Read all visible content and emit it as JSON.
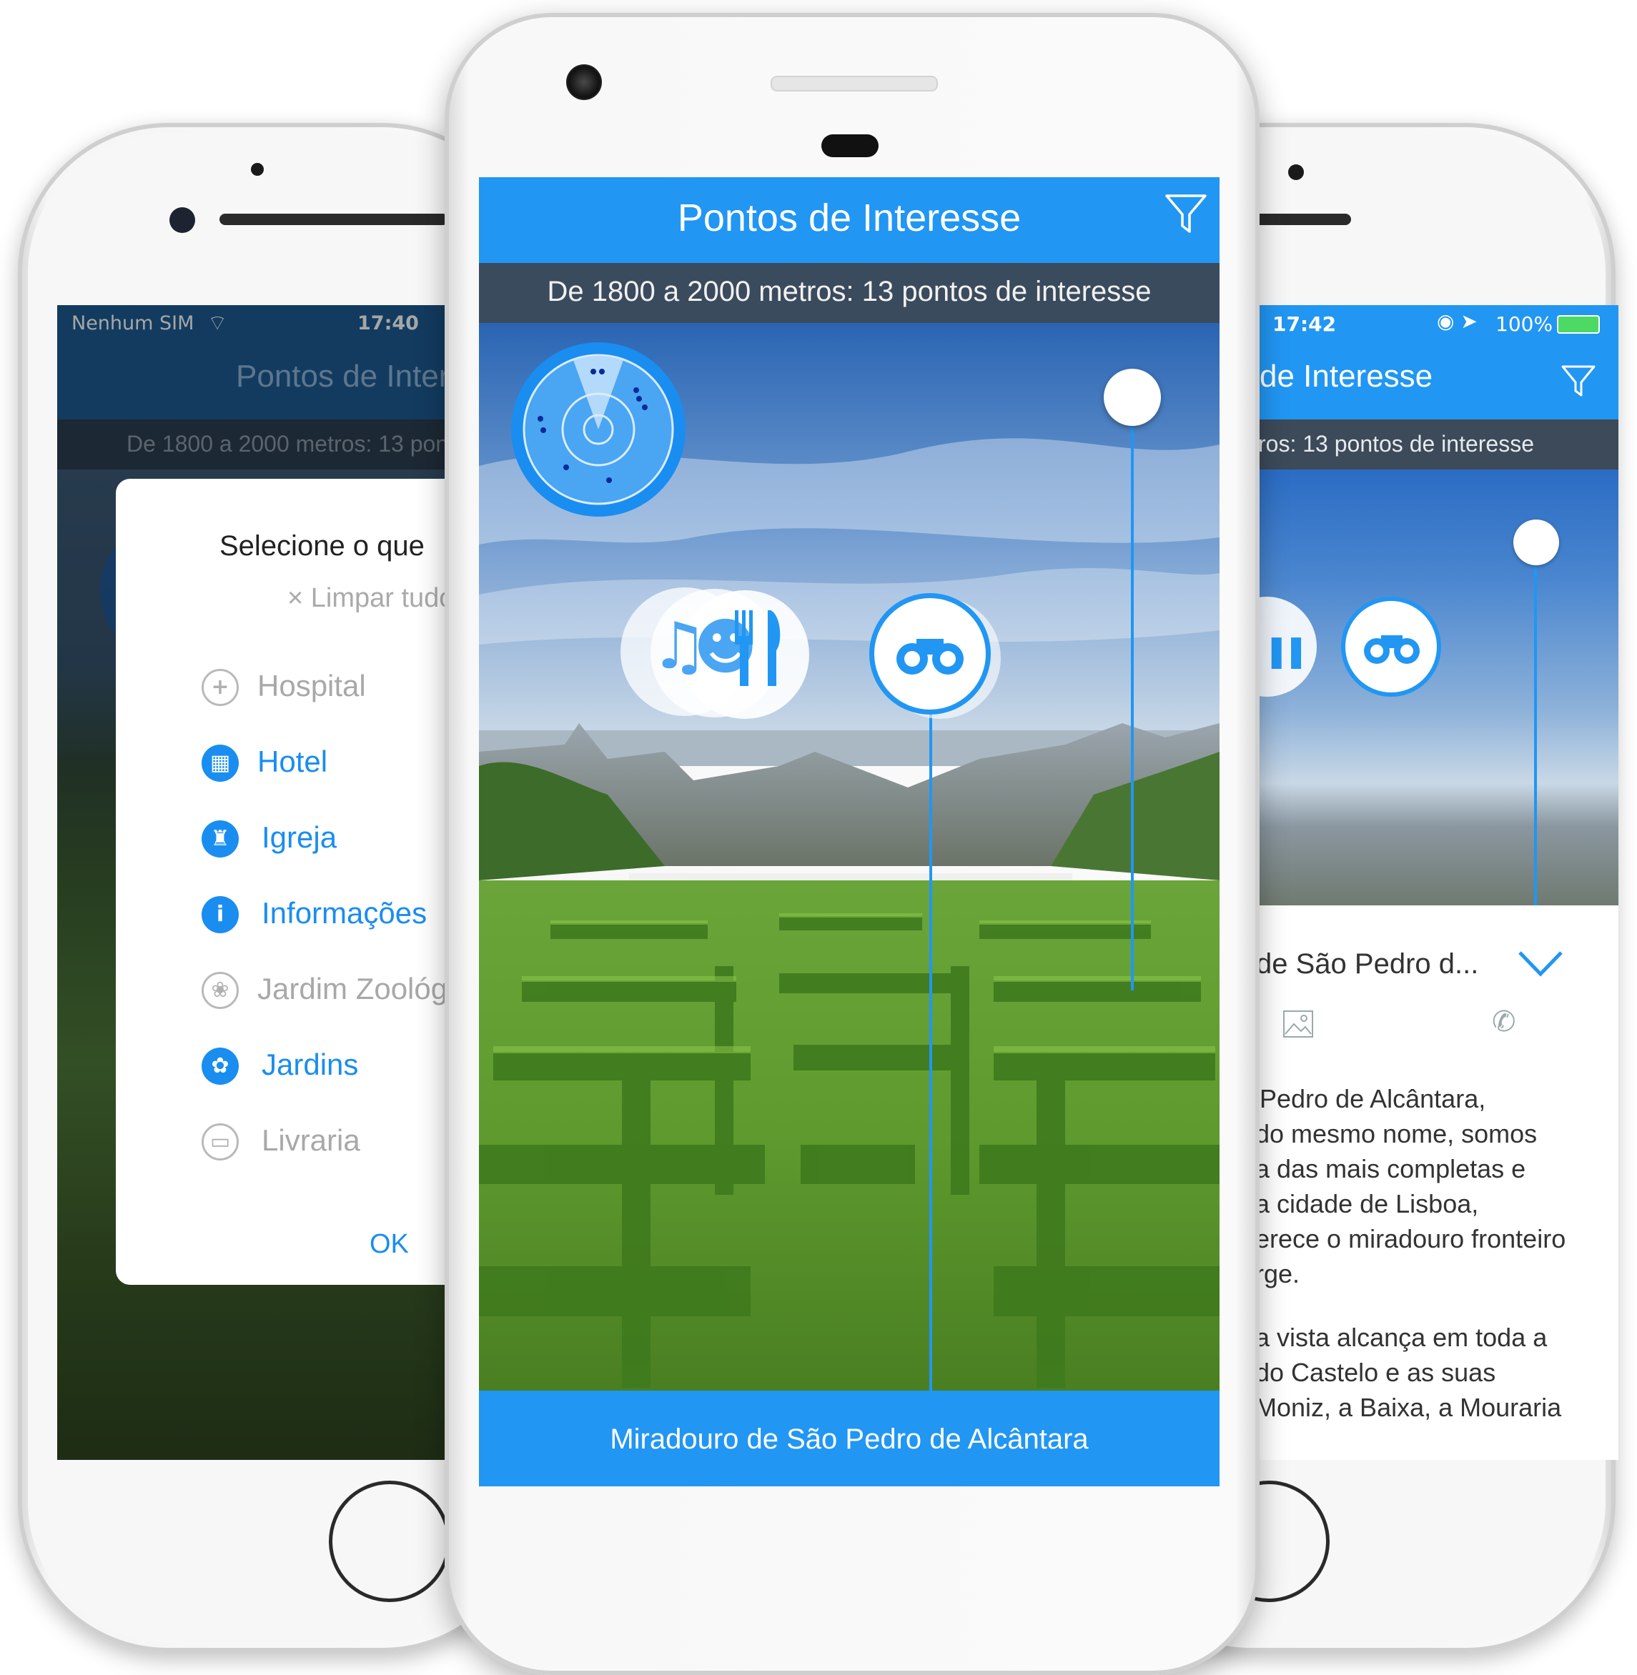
{
  "left_phone": {
    "status": {
      "carrier": "Nenhum SIM",
      "time": "17:40"
    },
    "nav_title": "Pontos de Interesse",
    "distance_summary": "De 1800 a 2000 metros: 13 pontos de interesse",
    "dialog": {
      "title": "Selecione o que",
      "clear_all": "× Limpar tudo",
      "items": [
        {
          "label": "Hospital",
          "selected": false,
          "icon": "plus-icon"
        },
        {
          "label": "Hotel",
          "selected": true,
          "icon": "building-icon"
        },
        {
          "label": "Igreja",
          "selected": true,
          "icon": "church-icon"
        },
        {
          "label": "Informações",
          "selected": true,
          "icon": "info-icon"
        },
        {
          "label": "Jardim Zoológico",
          "selected": false,
          "icon": "paw-icon"
        },
        {
          "label": "Jardins",
          "selected": true,
          "icon": "flower-icon"
        },
        {
          "label": "Livraria",
          "selected": false,
          "icon": "book-icon"
        }
      ],
      "ok": "OK"
    }
  },
  "center_phone": {
    "nav_title": "Pontos de Interesse",
    "distance_summary": "De 1800 a 2000 metros: 13 pontos de interesse",
    "selected_poi": "Miradouro de São Pedro de Alcântara",
    "colors": {
      "accent": "#2196f3",
      "subbar": "#3b4b5e"
    }
  },
  "right_phone": {
    "status": {
      "time": "17:42",
      "battery": "100%"
    },
    "nav_title": "de Interesse",
    "distance_summary": "ros: 13 pontos de interesse",
    "card": {
      "title": "de São Pedro d...",
      "paragraph1": [
        "Pedro de Alcântara,",
        "do mesmo nome, somos",
        "a das mais completas e",
        "a cidade de Lisboa,",
        "erece o miradouro fronteiro",
        "rge."
      ],
      "paragraph2": [
        "a vista alcança em toda a",
        "do Castelo e as suas",
        "Moniz, a Baixa, a Mouraria"
      ]
    }
  }
}
